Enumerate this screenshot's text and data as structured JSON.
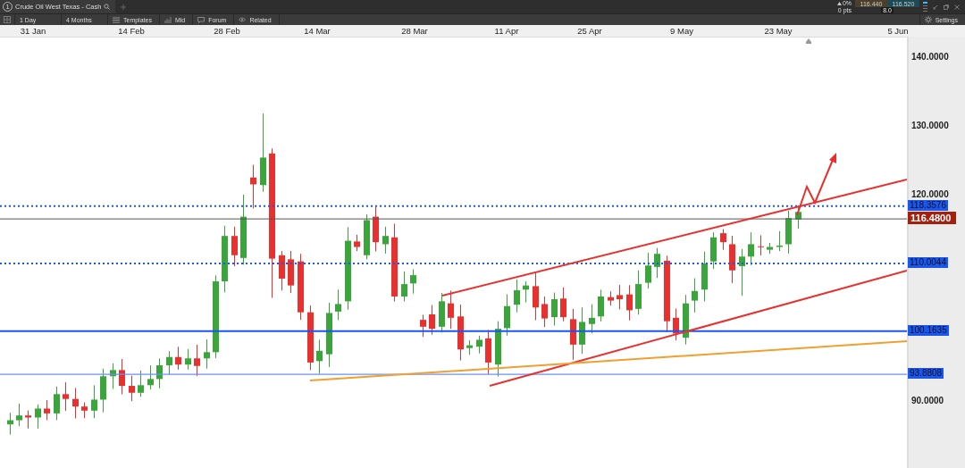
{
  "window": {
    "tab_number": "1",
    "title": "Crude Oil West Texas - Cash"
  },
  "toolbar": {
    "items": [
      {
        "kind": "text",
        "label": "1 Day"
      },
      {
        "kind": "text",
        "label": "4 Months"
      },
      {
        "kind": "templates",
        "label": "Templates"
      },
      {
        "kind": "mid",
        "label": "Mid"
      },
      {
        "kind": "forum",
        "label": "Forum"
      },
      {
        "kind": "related",
        "label": "Related"
      }
    ],
    "settings": "Settings"
  },
  "quote": {
    "change_pct": "0%",
    "change_pts": "0 pts",
    "bid": "116.440",
    "ask": "116.520",
    "spread": "8.0"
  },
  "date_axis": [
    "31 Jan",
    "14 Feb",
    "28 Feb",
    "14 Mar",
    "28 Mar",
    "11 Apr",
    "25 Apr",
    "9 May",
    "23 May",
    "5 Jun"
  ],
  "price_axis": [
    "140.0000",
    "130.0000",
    "120.0000",
    "90.0000"
  ],
  "levels": [
    {
      "label": "118.3576",
      "kind": "dotted",
      "color": "#1a56f0"
    },
    {
      "label": "116.4800",
      "kind": "current",
      "color": "#a3200f"
    },
    {
      "label": "110.0044",
      "kind": "dotted",
      "color": "#1a56f0"
    },
    {
      "label": "100.1635",
      "kind": "solid",
      "color": "#1a56f0"
    },
    {
      "label": "93.8808",
      "kind": "thin",
      "color": "#1a56f0"
    }
  ]
}
